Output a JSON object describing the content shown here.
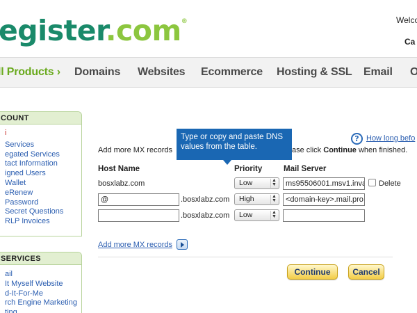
{
  "header": {
    "logo_part1": "egister",
    "logo_part2": ".com",
    "logo_reg": "®",
    "welcome": "Welco",
    "cart": "Ca"
  },
  "nav": {
    "items": [
      {
        "label": "ll Products ›"
      },
      {
        "label": "Domains"
      },
      {
        "label": "Websites"
      },
      {
        "label": "Ecommerce"
      },
      {
        "label": "Hosting & SSL"
      },
      {
        "label": "Email"
      },
      {
        "label": "O"
      }
    ]
  },
  "sidebar": {
    "account": {
      "title": "COUNT",
      "items": [
        {
          "label": "i"
        },
        {
          "label": "Services"
        },
        {
          "label": "egated Services"
        },
        {
          "label": "tact Information"
        },
        {
          "label": "igned Users"
        },
        {
          "label": "Wallet"
        },
        {
          "label": "eRenew"
        },
        {
          "label": "Password"
        },
        {
          "label": "Secret Questions"
        },
        {
          "label": "RLP Invoices"
        }
      ]
    },
    "services": {
      "title": "SERVICES",
      "items": [
        {
          "label": "ail"
        },
        {
          "label": "It Myself Website"
        },
        {
          "label": "d-It-For-Me"
        },
        {
          "label": "rch Engine Marketing"
        },
        {
          "label": "ting"
        }
      ]
    }
  },
  "tooltip": {
    "text": "Type or copy and paste DNS values from the table."
  },
  "help": {
    "icon": "?",
    "link": "How long befo"
  },
  "instructions": {
    "left": "Add more MX records",
    "right_prefix": "ase click ",
    "right_bold": "Continue",
    "right_suffix": " when finished."
  },
  "table": {
    "headers": {
      "host": "Host Name",
      "priority": "Priority",
      "mail": "Mail Server"
    },
    "rows": [
      {
        "host": "bosxlabz.com",
        "suffix": "",
        "priority": "Low",
        "mail": "ms95506001.msv1.inva",
        "delete_label": "Delete"
      },
      {
        "host": "@",
        "suffix": ".bosxlabz.com",
        "priority": "High",
        "mail": "<domain-key>.mail.pro"
      },
      {
        "host": "",
        "suffix": ".bosxlabz.com",
        "priority": "Low",
        "mail": ""
      }
    ]
  },
  "add_more_link": "Add more MX records",
  "buttons": {
    "continue": "Continue",
    "cancel": "Cancel"
  }
}
